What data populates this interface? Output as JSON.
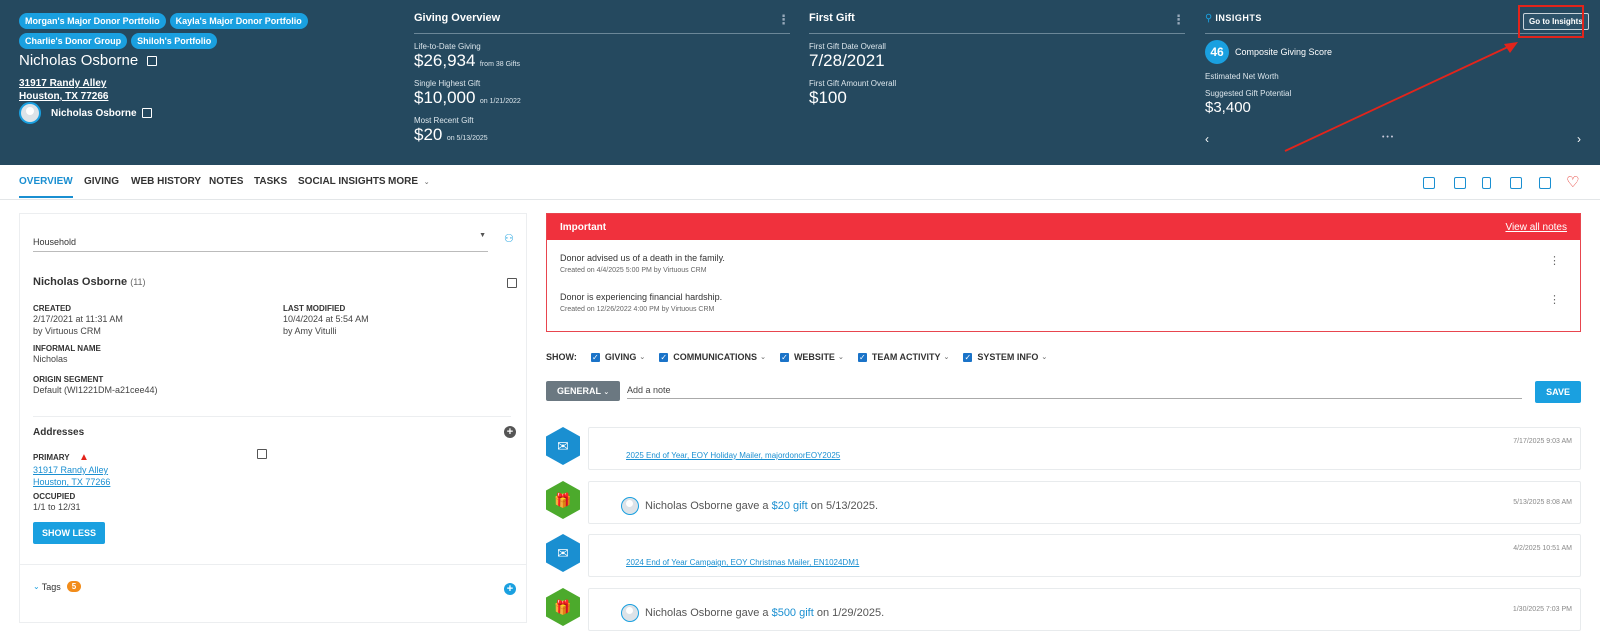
{
  "header": {
    "portfolios": [
      "Morgan's Major Donor Portfolio",
      "Kayla's Major Donor Portfolio",
      "Charlie's Donor Group",
      "Shiloh's Portfolio"
    ],
    "donor_name": "Nicholas Osborne",
    "address_line1": "31917 Randy Alley",
    "address_line2": "Houston, TX 77266",
    "contact_name": "Nicholas Osborne"
  },
  "giving_overview": {
    "title": "Giving Overview",
    "ltd_label": "Life-to-Date Giving",
    "ltd_value": "$26,934",
    "ltd_sub": "from 38 Gifts",
    "highest_label": "Single Highest Gift",
    "highest_value": "$10,000",
    "highest_sub": "on 1/21/2022",
    "recent_label": "Most Recent Gift",
    "recent_value": "$20",
    "recent_sub": "on 5/13/2025"
  },
  "first_gift": {
    "title": "First Gift",
    "date_label": "First Gift Date Overall",
    "date_value": "7/28/2021",
    "amount_label": "First Gift Amount Overall",
    "amount_value": "$100"
  },
  "insights": {
    "logo_small": "virtuous",
    "logo": "INSIGHTS",
    "button": "Go to Insights",
    "score": "46",
    "score_label": "Composite Giving Score",
    "net_worth_label": "Estimated Net Worth",
    "potential_label": "Suggested Gift Potential",
    "potential_value": "$3,400",
    "prev": "‹",
    "next": "›",
    "pager": "• • •"
  },
  "tabs": [
    "OVERVIEW",
    "GIVING",
    "WEB HISTORY",
    "NOTES",
    "TASKS",
    "SOCIAL INSIGHTS",
    "MORE"
  ],
  "household": {
    "select": "Household",
    "name": "Nicholas Osborne",
    "count": "(11)",
    "created_label": "CREATED",
    "created_value": "2/17/2021 at 11:31 AM",
    "created_by": "by Virtuous CRM",
    "modified_label": "LAST MODIFIED",
    "modified_value": "10/4/2024 at 5:54 AM",
    "modified_by": "by Amy Vitulli",
    "informal_label": "INFORMAL NAME",
    "informal_value": "Nicholas",
    "origin_label": "ORIGIN SEGMENT",
    "origin_value": "Default (WI1221DM-a21cee44)",
    "addresses_title": "Addresses",
    "primary_label": "PRIMARY",
    "address1": "31917 Randy Alley",
    "address2": "Houston, TX 77266",
    "occupied_label": "OCCUPIED",
    "occupied_value": "1/1 to 12/31",
    "show_less": "SHOW LESS",
    "tags_label": "Tags",
    "tags_count": "5"
  },
  "important": {
    "title": "Important",
    "view_all": "View all notes",
    "notes": [
      {
        "text": "Donor advised us of a death in the family.",
        "meta": "Created on 4/4/2025 5:00 PM by Virtuous CRM"
      },
      {
        "text": "Donor is experiencing financial hardship.",
        "meta": "Created on 12/26/2022 4:00 PM by Virtuous CRM"
      }
    ]
  },
  "filters": {
    "show_label": "SHOW:",
    "items": [
      "GIVING",
      "COMMUNICATIONS",
      "WEBSITE",
      "TEAM ACTIVITY",
      "SYSTEM INFO"
    ]
  },
  "compose": {
    "type": "GENERAL",
    "placeholder": "Add a note",
    "save": "SAVE"
  },
  "activity": [
    {
      "kind": "comm",
      "link": "2025 End of Year, EOY Holiday Mailer, majordonorEOY2025",
      "date": "7/17/2025 9:03 AM"
    },
    {
      "kind": "gift",
      "pre": "Nicholas Osborne gave a",
      "amount": "$20 gift",
      "post": "on 5/13/2025.",
      "date": "5/13/2025 8:08 AM"
    },
    {
      "kind": "comm",
      "link": "2024 End of Year Campaign, EOY Christmas Mailer, EN1024DM1",
      "date": "4/2/2025 10:51 AM"
    },
    {
      "kind": "gift",
      "pre": "Nicholas Osborne gave a",
      "amount": "$500 gift",
      "post": "on 1/29/2025.",
      "date": "1/30/2025 7:03 PM"
    }
  ],
  "colors": {
    "header_bg": "#25495f",
    "accent": "#1aa0e0",
    "alert": "#f0313d",
    "gift_green": "#4caa2c"
  }
}
